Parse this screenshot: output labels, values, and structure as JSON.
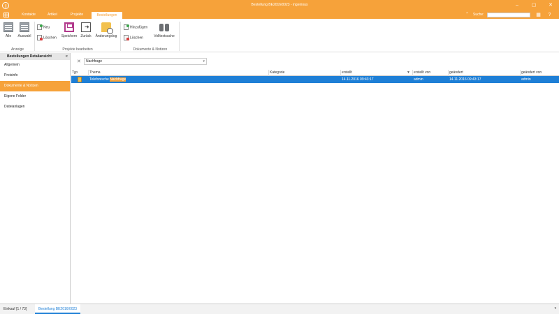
{
  "window": {
    "title": "Bestellung BE2016/0023 - ingenious"
  },
  "ribbon_tabs": [
    {
      "label": "Kontakte"
    },
    {
      "label": "Artikel"
    },
    {
      "label": "Projekte"
    },
    {
      "label": "Bestellungen"
    }
  ],
  "search": {
    "label": "Suche:",
    "value": ""
  },
  "ribbon": {
    "anzeige": {
      "label": "Anzeige",
      "buttons": [
        {
          "label": "Alle"
        },
        {
          "label": "Auswahl"
        }
      ]
    },
    "projekte": {
      "label": "Projekte bearbeiten",
      "new_label": "Neu",
      "delete_label": "Löschen",
      "save_label": "Speichern",
      "back_label": "Zurück",
      "log_label": "Änderungslog"
    },
    "dokumente": {
      "label": "Dokumente & Notizen",
      "add_label": "Hinzufügen",
      "delete_label": "Löschen",
      "fulltext_label": "Volltextsuche"
    }
  },
  "sidebar": {
    "title": "Bestellungen Detailansicht",
    "items": [
      {
        "label": "Allgemein"
      },
      {
        "label": "Preisinfo"
      },
      {
        "label": "Dokumente & Notizen"
      },
      {
        "label": "Eigene Felder"
      },
      {
        "label": "Dateianlagen"
      }
    ]
  },
  "filter": {
    "value": "Nachfrage"
  },
  "table": {
    "headers": {
      "typ": "Typ",
      "thema": "Thema",
      "kategorie": "Kategorie",
      "erstellt": "erstellt",
      "erstellt_von": "erstellt von",
      "geaendert": "geändert",
      "geaendert_von": "geändert von"
    },
    "rows": [
      {
        "thema_prefix": "Telefonische ",
        "thema_match": "Nachfrage",
        "kategorie": "",
        "erstellt": "14.11.2016 09:43:17",
        "erstellt_von": "admin",
        "geaendert": "14.11.2016 09:43:17",
        "geaendert_von": "admin"
      }
    ]
  },
  "bottom_tabs": [
    {
      "label": "Einkauf [1 / 73]"
    },
    {
      "label": "Bestellung BE2016/0023"
    }
  ],
  "colors": {
    "accent": "#f6a23a",
    "selection": "#1e7fd6"
  }
}
